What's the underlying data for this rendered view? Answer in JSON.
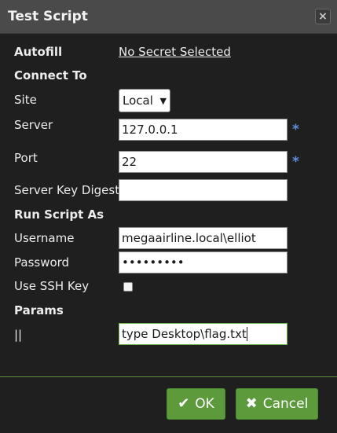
{
  "dialog": {
    "title": "Test Script",
    "close_icon": "×"
  },
  "form": {
    "autofill_label": "Autofill",
    "autofill_value": "No Secret Selected",
    "connect_heading": "Connect To",
    "site_label": "Site",
    "site_value": "Local",
    "server_label": "Server",
    "server_value": "127.0.0.1",
    "port_label": "Port",
    "port_value": "22",
    "required_mark": "*",
    "server_key_digest_label": "Server Key Digest",
    "server_key_digest_value": "",
    "run_as_heading": "Run Script As",
    "username_label": "Username",
    "username_value": "megaairline.local\\elliot",
    "password_label": "Password",
    "password_value": "•••••••••",
    "use_ssh_key_label": "Use SSH Key",
    "use_ssh_key_checked": false,
    "params_heading": "Params",
    "param_label": "||",
    "param_value": "type Desktop\\flag.txt"
  },
  "buttons": {
    "ok_label": "OK",
    "cancel_label": "Cancel",
    "ok_icon": "check-icon",
    "cancel_icon": "x-icon"
  },
  "colors": {
    "accent": "#5c9a3c",
    "required": "#5e8fdc",
    "titlebar": "#4a4a4a",
    "background": "#1f1f1f"
  }
}
